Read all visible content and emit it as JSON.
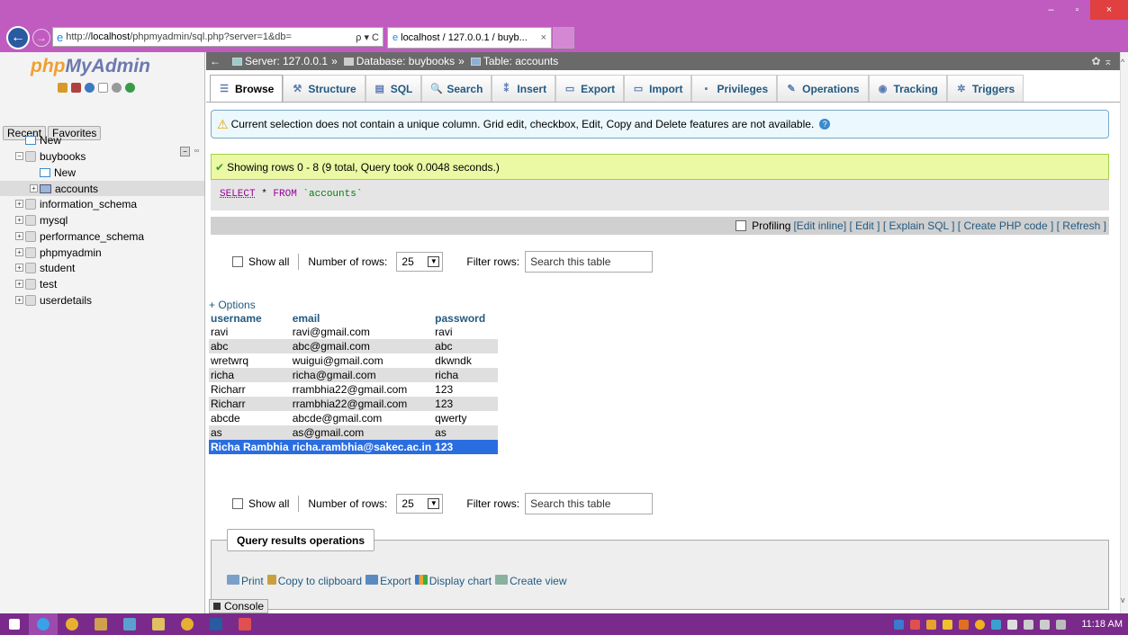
{
  "browser": {
    "url_prefix": "http://",
    "url_host": "localhost",
    "url_path": "/phpmyadmin/sql.php?server=1&db=",
    "url_controls": "ρ ▾ C",
    "tab_title": "localhost / 127.0.0.1 / buyb...",
    "tab_close": "×",
    "minimize": "–",
    "maximize": "▫",
    "close": "×",
    "right_icons": "⌂ ★ ✿"
  },
  "sidebar": {
    "logo_php": "php",
    "logo_rest": "MyAdmin",
    "recent_label": "Recent",
    "favorites_label": "Favorites",
    "tree": [
      {
        "label": "New",
        "kind": "new",
        "indent": 0
      },
      {
        "label": "buybooks",
        "kind": "db",
        "indent": 0,
        "expanded": true
      },
      {
        "label": "New",
        "kind": "new",
        "indent": 1
      },
      {
        "label": "accounts",
        "kind": "table",
        "indent": 1,
        "selected": true
      },
      {
        "label": "information_schema",
        "kind": "db",
        "indent": 0
      },
      {
        "label": "mysql",
        "kind": "db",
        "indent": 0
      },
      {
        "label": "performance_schema",
        "kind": "db",
        "indent": 0
      },
      {
        "label": "phpmyadmin",
        "kind": "db",
        "indent": 0
      },
      {
        "label": "student",
        "kind": "db",
        "indent": 0
      },
      {
        "label": "test",
        "kind": "db",
        "indent": 0
      },
      {
        "label": "userdetails",
        "kind": "db",
        "indent": 0
      }
    ]
  },
  "breadcrumb": {
    "arrow": "←",
    "server": "Server: 127.0.0.1",
    "sep": "»",
    "database": "Database: buybooks",
    "table": "Table: accounts",
    "right": "✿ ⌅"
  },
  "tabs": [
    {
      "label": "Browse",
      "icon": "☰",
      "active": true
    },
    {
      "label": "Structure",
      "icon": "⚒"
    },
    {
      "label": "SQL",
      "icon": "▤"
    },
    {
      "label": "Search",
      "icon": "🔍"
    },
    {
      "label": "Insert",
      "icon": "⁑"
    },
    {
      "label": "Export",
      "icon": "▭"
    },
    {
      "label": "Import",
      "icon": "▭"
    },
    {
      "label": "Privileges",
      "icon": "▪"
    },
    {
      "label": "Operations",
      "icon": "✎"
    },
    {
      "label": "Tracking",
      "icon": "◉"
    },
    {
      "label": "Triggers",
      "icon": "✲"
    }
  ],
  "messages": {
    "warning": "Current selection does not contain a unique column. Grid edit, checkbox, Edit, Copy and Delete features are not available.",
    "success": "Showing rows 0 - 8 (9 total, Query took 0.0048 seconds.)"
  },
  "sql": {
    "kw1": "SELECT",
    "star": " * ",
    "kw2": "FROM",
    "table": " `accounts`"
  },
  "profiling": {
    "label": "Profiling",
    "edit_inline": "[Edit inline]",
    "edit": "[ Edit ]",
    "explain": "[ Explain SQL ]",
    "create_php": "[ Create PHP code ]",
    "refresh": "[ Refresh ]"
  },
  "nav": {
    "show_all": "Show all",
    "rows_label": "Number of rows:",
    "rows_value": "25",
    "filter_label": "Filter rows:",
    "filter_placeholder": "Search this table"
  },
  "results": {
    "options": "+ Options",
    "columns": [
      "username",
      "email",
      "password"
    ],
    "rows": [
      [
        "ravi",
        "ravi@gmail.com",
        "ravi"
      ],
      [
        "abc",
        "abc@gmail.com",
        "abc"
      ],
      [
        "wretwrq",
        "wuigui@gmail.com",
        "dkwndk"
      ],
      [
        "richa",
        "richa@gmail.com",
        "richa"
      ],
      [
        "Richarr",
        "rrambhia22@gmail.com",
        "123"
      ],
      [
        "Richarr",
        "rrambhia22@gmail.com",
        "123"
      ],
      [
        "abcde",
        "abcde@gmail.com",
        "qwerty"
      ],
      [
        "as",
        "as@gmail.com",
        "as"
      ],
      [
        "Richa Rambhia",
        "richa.rambhia@sakec.ac.in",
        "123"
      ]
    ]
  },
  "query_ops": {
    "title": "Query results operations",
    "print": "Print",
    "copy": "Copy to clipboard",
    "export": "Export",
    "chart": "Display chart",
    "view": "Create view"
  },
  "console_label": "Console",
  "taskbar": {
    "clock": "11:18 AM"
  },
  "colors": {
    "window_chrome": "#c05cc0",
    "taskbar": "#7a2a8a",
    "link": "#235a81",
    "highlight_row": "#2a6de0"
  }
}
